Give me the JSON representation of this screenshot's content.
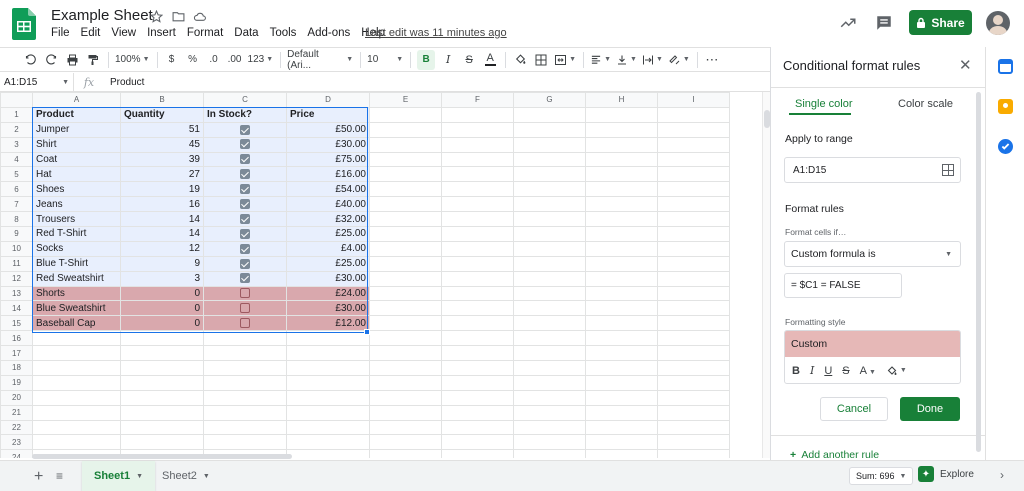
{
  "header": {
    "title": "Example Sheet",
    "menus": [
      "File",
      "Edit",
      "View",
      "Insert",
      "Format",
      "Data",
      "Tools",
      "Add-ons",
      "Help"
    ],
    "last_edit": "Last edit was 11 minutes ago",
    "share_label": "Share",
    "icons": [
      "star-icon",
      "folder-icon",
      "cloud-icon",
      "trending-icon",
      "comment-icon",
      "lock-icon"
    ]
  },
  "toolbar": {
    "zoom": "100%",
    "currency": "$",
    "percent": "%",
    "dec_less": ".0",
    "dec_more": ".00",
    "more_formats": "123",
    "font": "Default (Ari...",
    "font_size": "10",
    "bold": "B",
    "italic": "I",
    "strike": "S",
    "text_color": "A",
    "more": "⋯"
  },
  "formula_bar": {
    "name_box": "A1:D15",
    "fx": "fx",
    "value": "Product"
  },
  "grid": {
    "columns": [
      "A",
      "B",
      "C",
      "D",
      "E",
      "F",
      "G",
      "H",
      "I"
    ],
    "header_row": [
      "Product",
      "Quantity",
      "In Stock?",
      "Price"
    ],
    "rows": [
      {
        "product": "Jumper",
        "qty": "51",
        "stock": true,
        "price": "£50.00"
      },
      {
        "product": "Shirt",
        "qty": "45",
        "stock": true,
        "price": "£30.00"
      },
      {
        "product": "Coat",
        "qty": "39",
        "stock": true,
        "price": "£75.00"
      },
      {
        "product": "Hat",
        "qty": "27",
        "stock": true,
        "price": "£16.00"
      },
      {
        "product": "Shoes",
        "qty": "19",
        "stock": true,
        "price": "£54.00"
      },
      {
        "product": "Jeans",
        "qty": "16",
        "stock": true,
        "price": "£40.00"
      },
      {
        "product": "Trousers",
        "qty": "14",
        "stock": true,
        "price": "£32.00"
      },
      {
        "product": "Red T-Shirt",
        "qty": "14",
        "stock": true,
        "price": "£25.00"
      },
      {
        "product": "Socks",
        "qty": "12",
        "stock": true,
        "price": "£4.00"
      },
      {
        "product": "Blue T-Shirt",
        "qty": "9",
        "stock": true,
        "price": "£25.00"
      },
      {
        "product": "Red Sweatshirt",
        "qty": "3",
        "stock": true,
        "price": "£30.00"
      },
      {
        "product": "Shorts",
        "qty": "0",
        "stock": false,
        "price": "£24.00"
      },
      {
        "product": "Blue Sweatshirt",
        "qty": "0",
        "stock": false,
        "price": "£30.00"
      },
      {
        "product": "Baseball Cap",
        "qty": "0",
        "stock": false,
        "price": "£12.00"
      }
    ],
    "row_numbers": [
      "1",
      "2",
      "3",
      "4",
      "5",
      "6",
      "7",
      "8",
      "9",
      "10",
      "11",
      "12",
      "13",
      "14",
      "15",
      "16",
      "17",
      "18",
      "19",
      "20",
      "21",
      "22",
      "23",
      "24"
    ],
    "colors": {
      "in_stock_fill": "#e8effd",
      "out_of_stock_fill": "#d9a8ad",
      "selection": "#1a73e8"
    }
  },
  "sheet_tabs": {
    "tabs": [
      "Sheet1",
      "Sheet2"
    ],
    "active": "Sheet1",
    "sum": "Sum: 696",
    "explore": "Explore"
  },
  "panel": {
    "title": "Conditional format rules",
    "tab_single": "Single color",
    "tab_scale": "Color scale",
    "apply_label": "Apply to range",
    "range": "A1:D15",
    "rules_label": "Format rules",
    "cells_if_label": "Format cells if…",
    "condition": "Custom formula is",
    "formula": "= $C1 = FALSE",
    "style_label": "Formatting style",
    "style_preview": "Custom",
    "style_color": "#e6b8b7",
    "cancel": "Cancel",
    "done": "Done",
    "add_rule": "Add another rule"
  },
  "colors": {
    "brand_green": "#188038",
    "accent_blue": "#1a73e8"
  }
}
